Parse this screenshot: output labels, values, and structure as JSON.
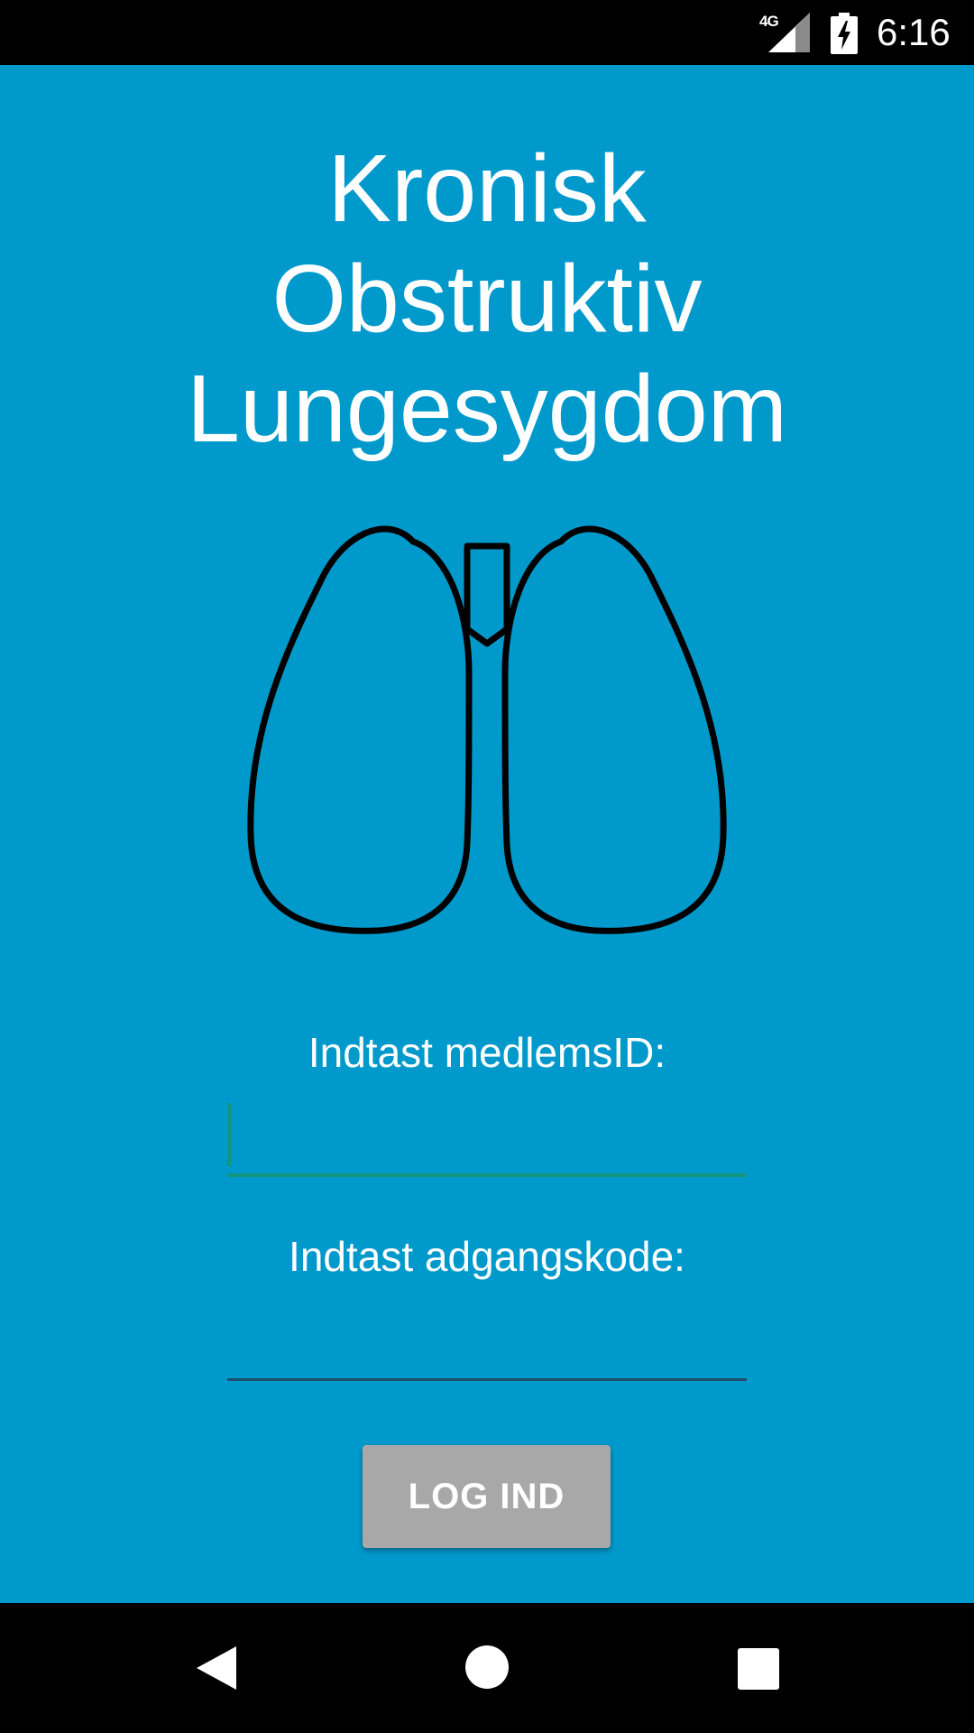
{
  "status_bar": {
    "network": "4G",
    "time": "6:16",
    "icons": [
      "signal-icon",
      "battery-charging-icon"
    ]
  },
  "app": {
    "title_lines": [
      "Kronisk",
      "Obstruktiv",
      "Lungesygdom"
    ],
    "logo_icon": "lungs-icon"
  },
  "login_form": {
    "member_id_label": "Indtast medlemsID:",
    "member_id_value": "",
    "password_label": "Indtast adgangskode:",
    "password_value": "",
    "submit_label": "LOG IND"
  },
  "nav_bar": {
    "icons": [
      "back-icon",
      "home-icon",
      "recents-icon"
    ]
  },
  "colors": {
    "background": "#0099cc",
    "bars": "#000000",
    "text": "#ffffff",
    "active_underline": "#14967c",
    "inactive_underline": "#1d4e6a",
    "button": "#a8a8a8"
  }
}
